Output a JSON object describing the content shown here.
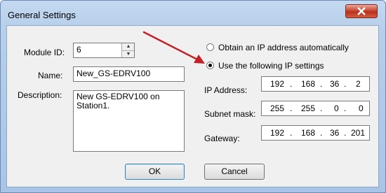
{
  "window": {
    "title": "General Settings"
  },
  "module": {
    "id_label": "Module ID:",
    "id_value": "6"
  },
  "name": {
    "label": "Name:",
    "value": "New_GS-EDRV100"
  },
  "description": {
    "label": "Description:",
    "value": "New GS-EDRV100 on Station1."
  },
  "ip_mode": {
    "auto_label": "Obtain an IP address automatically",
    "manual_label": "Use the following IP settings",
    "selected": "manual"
  },
  "ip_address": {
    "label": "IP Address:",
    "octets": [
      "192",
      "168",
      "36",
      "2"
    ]
  },
  "subnet": {
    "label": "Subnet mask:",
    "octets": [
      "255",
      "255",
      "0",
      "0"
    ]
  },
  "gateway": {
    "label": "Gateway:",
    "octets": [
      "192",
      "168",
      "36",
      "201"
    ]
  },
  "buttons": {
    "ok": "OK",
    "cancel": "Cancel"
  },
  "colors": {
    "arrow": "#c42026",
    "titlebar": "#b7cfeb",
    "close": "#c94a35"
  }
}
